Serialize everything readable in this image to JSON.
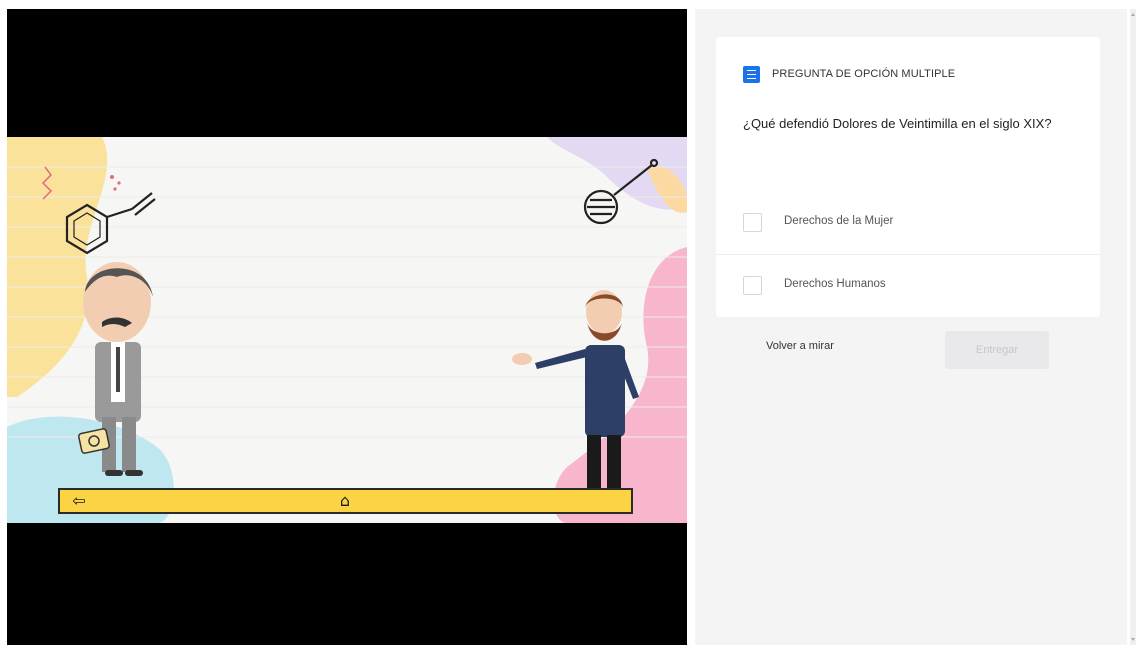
{
  "quiz": {
    "type_label": "PREGUNTA DE OPCIÓN MULTIPLE",
    "type_icon": "list-icon",
    "question": "¿Qué defendió Dolores de Veintimilla en el siglo XIX?",
    "options": [
      {
        "label": "Derechos de la Mujer",
        "checked": false
      },
      {
        "label": "Derechos Humanos",
        "checked": false
      }
    ],
    "rewatch_label": "Volver a mirar",
    "submit_label": "Entregar"
  },
  "slide": {
    "nav_back_icon": "back-arrow-icon",
    "nav_home_icon": "home-icon"
  },
  "colors": {
    "accent": "#1a73e8",
    "nav_bar": "#fcd443",
    "video_bg": "#000000",
    "panel_bg": "#f4f4f5"
  }
}
